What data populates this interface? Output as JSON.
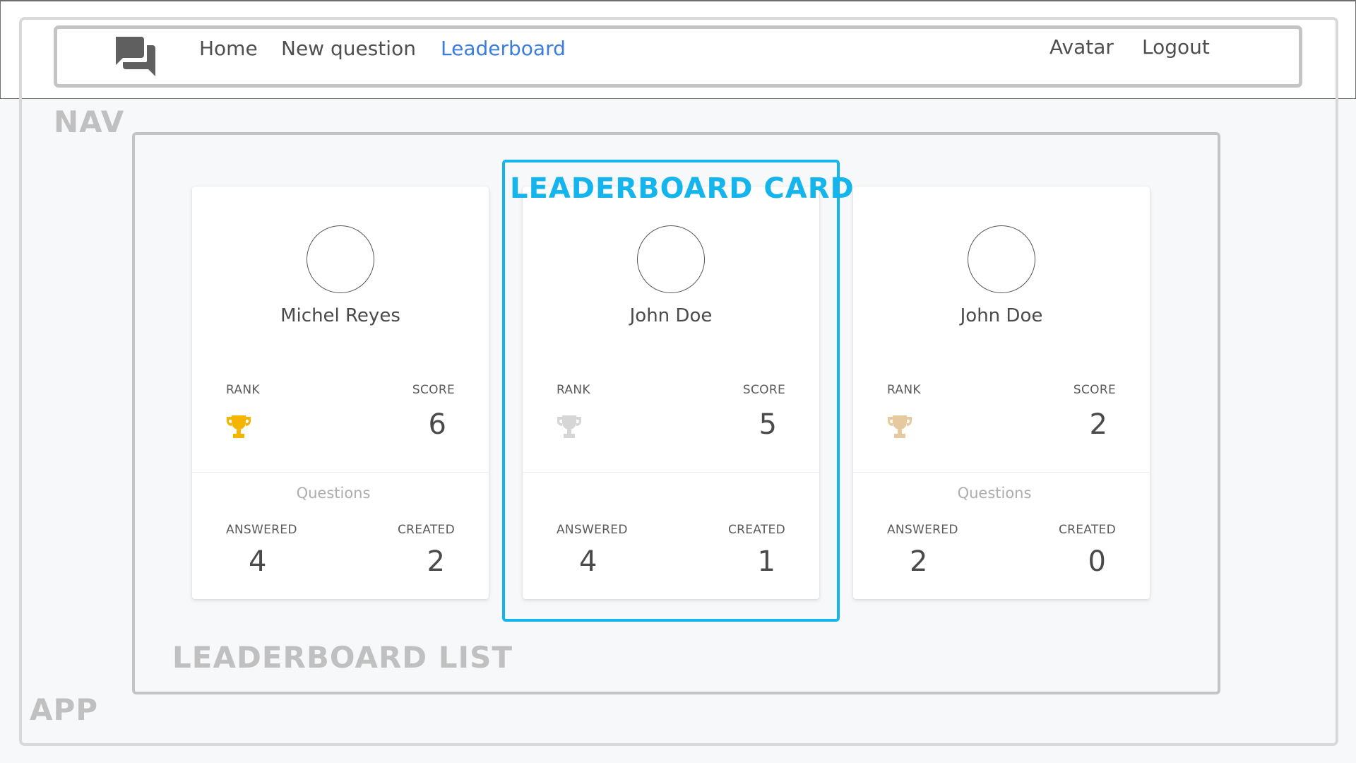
{
  "nav": {
    "logo_icon": "chat-bubbles-icon",
    "links": [
      "Home",
      "New question",
      "Leaderboard"
    ],
    "active_link": "Leaderboard",
    "active_color": "#3b7ddd",
    "right_links": [
      "Avatar",
      "Logout"
    ]
  },
  "annotations": {
    "nav": "NAV",
    "app": "APP",
    "list": "LEADERBOARD LIST",
    "card": "LEADERBOARD CARD",
    "highlight_color": "#14b4ec"
  },
  "leaderboard": {
    "labels": {
      "rank": "RANK",
      "score": "SCORE",
      "questions": "Questions",
      "answered": "ANSWERED",
      "created": "CREATED"
    },
    "cards": [
      {
        "name": "Michel Reyes",
        "rank_icon": "trophy-gold-icon",
        "trophy_color": "#f5b400",
        "score": "6",
        "questions_label": "Questions",
        "answered": "4",
        "created": "2"
      },
      {
        "name": "John Doe",
        "rank_icon": "trophy-silver-icon",
        "trophy_color": "#d6d6d6",
        "score": "5",
        "questions_label": "",
        "answered": "4",
        "created": "1"
      },
      {
        "name": "John Doe",
        "rank_icon": "trophy-bronze-icon",
        "trophy_color": "#e7c9a0",
        "score": "2",
        "questions_label": "Questions",
        "answered": "2",
        "created": "0"
      }
    ]
  }
}
